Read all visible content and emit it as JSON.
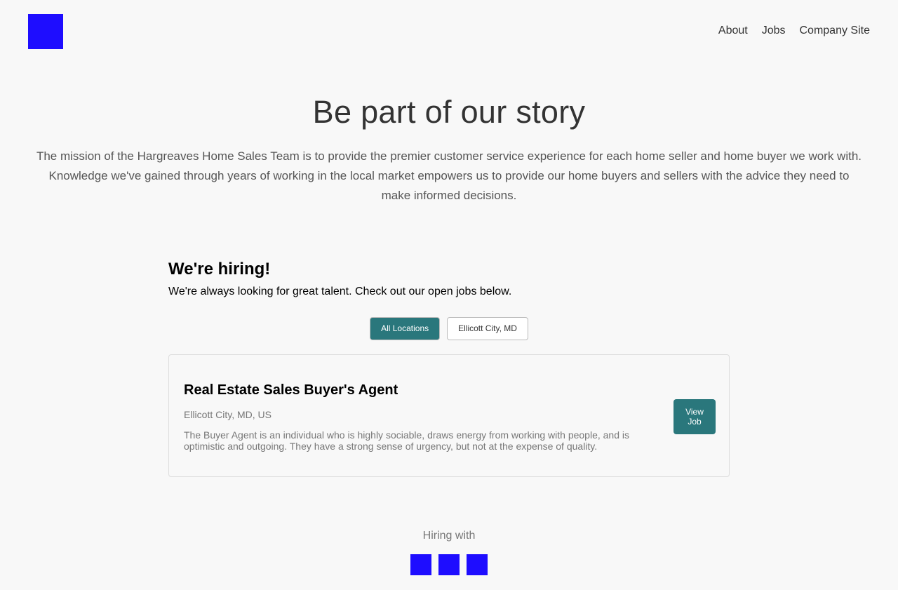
{
  "header": {
    "logo_icon": "company-logo-icon",
    "nav": {
      "about": "About",
      "jobs": "Jobs",
      "company_site": "Company Site"
    }
  },
  "hero": {
    "title": "Be part of our story",
    "text": "The mission of the Hargreaves Home Sales Team is to provide the premier customer service experience for each home seller and home buyer we work with. Knowledge we've gained through years of working in the local market empowers us to provide our home buyers and sellers with the advice they need to make informed decisions."
  },
  "hiring": {
    "title": "We're hiring!",
    "subtitle": "We're always looking for great talent. Check out our open jobs below.",
    "filters": {
      "all": "All Locations",
      "ellicott": "Ellicott City, MD",
      "selected": "All Locations"
    }
  },
  "jobs": [
    {
      "title": "Real Estate Sales Buyer's Agent",
      "location": "Ellicott City, MD, US",
      "description": "The Buyer Agent is an individual who is highly sociable, draws energy from working with people, and is optimistic and outgoing. They have a strong sense of urgency, but not at the expense of quality.",
      "button": "View Job"
    }
  ],
  "footer": {
    "label": "Hiring with",
    "icons": [
      "social-icon-1",
      "social-icon-2",
      "social-icon-3"
    ]
  },
  "colors": {
    "accent": "#2a777c",
    "brand": "#1e0dff",
    "background": "#f8f8f8"
  }
}
